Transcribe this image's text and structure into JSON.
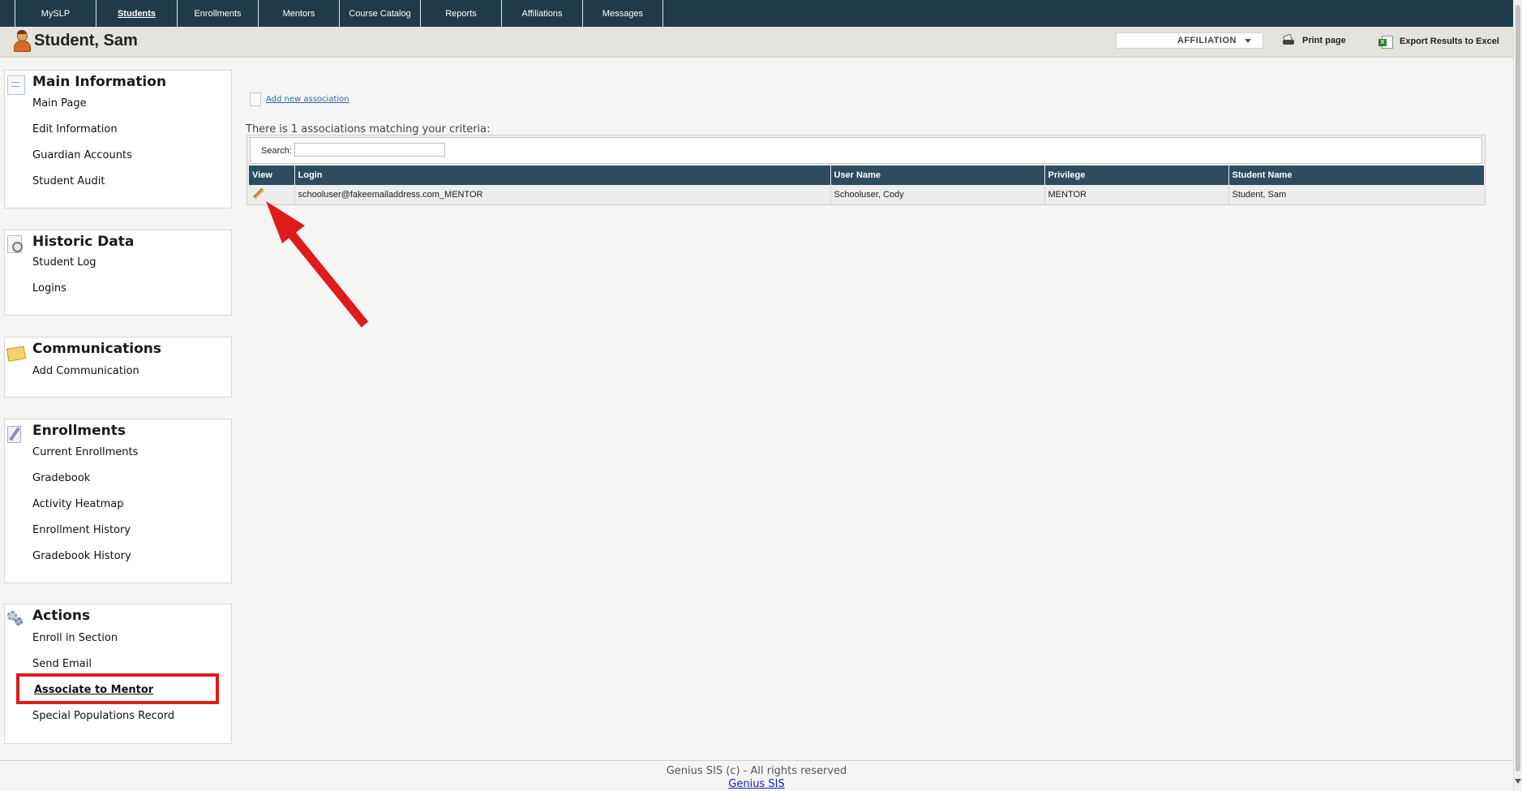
{
  "nav": {
    "tabs": [
      "MySLP",
      "Students",
      "Enrollments",
      "Mentors",
      "Course Catalog",
      "Reports",
      "Affiliations",
      "Messages"
    ],
    "active_tab": "Students"
  },
  "header": {
    "student_name": "Student, Sam",
    "affiliation_select": "AFFILIATION",
    "print_label": "Print page",
    "export_label": "Export Results to Excel"
  },
  "sidebar": {
    "main_information": {
      "title": "Main Information",
      "links": [
        "Main Page",
        "Edit Information",
        "Guardian Accounts",
        "Student Audit"
      ]
    },
    "historic_data": {
      "title": "Historic Data",
      "links": [
        "Student Log",
        "Logins"
      ]
    },
    "communications": {
      "title": "Communications",
      "links": [
        "Add Communication"
      ]
    },
    "enrollments": {
      "title": "Enrollments",
      "links": [
        "Current Enrollments",
        "Gradebook",
        "Activity Heatmap",
        "Enrollment History",
        "Gradebook History"
      ]
    },
    "actions": {
      "title": "Actions",
      "links": [
        "Enroll in Section",
        "Send Email",
        "Associate to Mentor",
        "Special Populations Record"
      ],
      "highlighted": "Associate to Mentor"
    }
  },
  "main": {
    "add_link": "Add new association",
    "match_text": "There is 1 associations matching your criteria:",
    "search_label": "Search:",
    "search_value": "",
    "table": {
      "headers": [
        "View",
        "Login",
        "User Name",
        "Privilege",
        "Student Name"
      ],
      "rows": [
        {
          "view_icon": "pencil-icon",
          "login": "schooluser@fakeemailaddress.com_MENTOR",
          "user_name": "Schooluser, Cody",
          "privilege": "MENTOR",
          "student_name": "Student, Sam"
        }
      ]
    }
  },
  "footer": {
    "copyright": "Genius SIS (c) - All rights reserved",
    "link": "Genius SIS"
  },
  "colors": {
    "nav_bg": "#1f3b4a",
    "table_header_bg": "#2b4d5e",
    "annotation_red": "#e01b1b"
  }
}
